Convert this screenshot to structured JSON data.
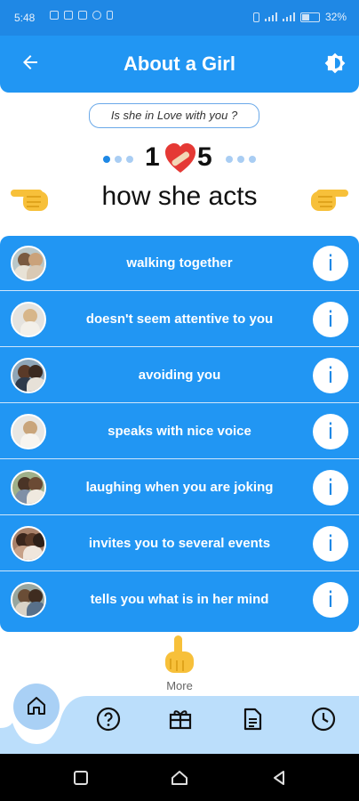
{
  "status_bar": {
    "time": "5:48",
    "battery_percent": "32%",
    "notification_icons": [
      "sim-icon",
      "image-icon",
      "mail-icon",
      "vpn-icon",
      "phone-icon"
    ]
  },
  "app_bar": {
    "title": "About a Girl",
    "back_icon": "arrow-left-icon",
    "theme_icon": "brightness-icon"
  },
  "question_pill": "Is she in Love with you ?",
  "progress": {
    "current": "1",
    "total": "5",
    "heart_icon": "broken-heart-icon",
    "active_dot": 0
  },
  "section_title": "how she acts",
  "items": [
    {
      "label": "walking together"
    },
    {
      "label": "doesn't seem attentive to you"
    },
    {
      "label": "avoiding you"
    },
    {
      "label": "speaks with nice voice"
    },
    {
      "label": "laughing when you are joking"
    },
    {
      "label": "invites you to several events"
    },
    {
      "label": "tells you what is in her mind"
    }
  ],
  "info_glyph": "i",
  "more_label": "More",
  "bottom_nav": [
    "home-icon",
    "help-icon",
    "gift-icon",
    "document-icon",
    "clock-icon"
  ],
  "colors": {
    "primary": "#2196f3",
    "status_bar": "#1f88e5",
    "nav_background": "#bbdefb",
    "accent_dot": "#1e88e5"
  }
}
